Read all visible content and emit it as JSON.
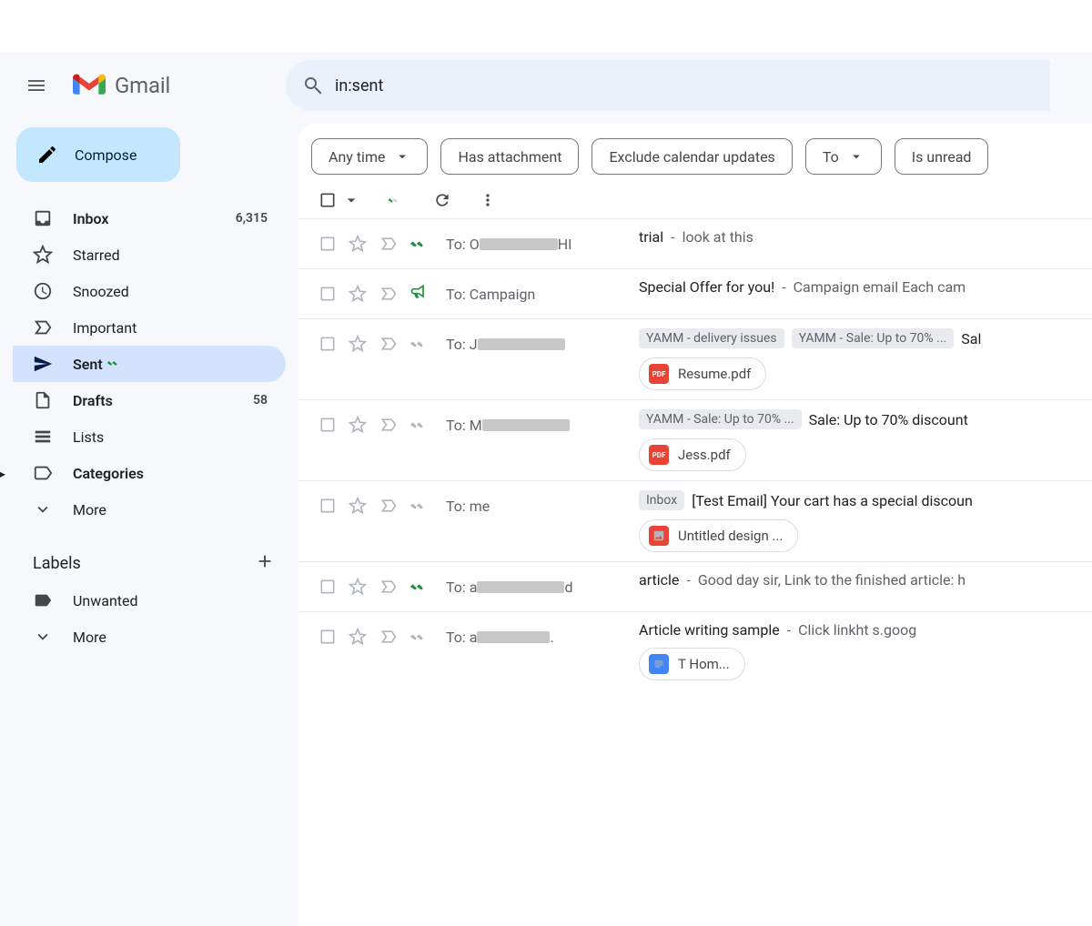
{
  "header": {
    "brand": "Gmail",
    "search_value": "in:sent"
  },
  "compose_label": "Compose",
  "sidebar": [
    {
      "icon": "inbox",
      "label": "Inbox",
      "count": "6,315",
      "bold": true
    },
    {
      "icon": "star",
      "label": "Starred"
    },
    {
      "icon": "clock",
      "label": "Snoozed"
    },
    {
      "icon": "important",
      "label": "Important"
    },
    {
      "icon": "send",
      "label": "Sent",
      "selected": true,
      "tick": true
    },
    {
      "icon": "file",
      "label": "Drafts",
      "count": "58",
      "bold": true
    },
    {
      "icon": "lists",
      "label": "Lists"
    },
    {
      "icon": "cat",
      "label": "Categories",
      "caret": true,
      "bold": true
    },
    {
      "icon": "more",
      "label": "More"
    }
  ],
  "labels_header": "Labels",
  "labels": [
    {
      "icon": "tag",
      "label": "Unwanted"
    },
    {
      "icon": "more",
      "label": "More"
    }
  ],
  "chips": [
    {
      "label": "Any time",
      "dropdown": true
    },
    {
      "label": "Has attachment"
    },
    {
      "label": "Exclude calendar updates"
    },
    {
      "label": "To",
      "dropdown": true
    },
    {
      "label": "Is unread"
    }
  ],
  "to_prefix": "To: ",
  "rows": [
    {
      "tick": "green",
      "sender_pre": "O",
      "sender_post": "HI",
      "redact": 86,
      "subject": "trial",
      "snippet": "look at this"
    },
    {
      "tick": "bullhorn",
      "sender_text": "Campaign",
      "subject": "Special Offer for you!",
      "snippet": "Campaign email Each cam"
    },
    {
      "tick": "gray",
      "sender_pre": "J",
      "redact": 96,
      "tags": [
        "YAMM - delivery issues",
        "YAMM - Sale: Up to 70% ..."
      ],
      "subject_tail": "Sal",
      "attachments": [
        {
          "type": "pdf",
          "label": "Resume.pdf"
        }
      ]
    },
    {
      "tick": "gray",
      "sender_pre": "M",
      "redact": 96,
      "tags": [
        "YAMM - Sale: Up to 70% ..."
      ],
      "subject_tail": "Sale: Up to 70% discount",
      "attachments": [
        {
          "type": "pdf",
          "label": "Jess.pdf"
        }
      ]
    },
    {
      "tick": "gray",
      "sender_text": "me",
      "tags": [
        "Inbox"
      ],
      "subject_tail": "[Test Email] Your cart has a special discoun",
      "attachments": [
        {
          "type": "img",
          "label": "Untitled design ..."
        }
      ]
    },
    {
      "tick": "green",
      "sender_pre": "a",
      "sender_post": "d",
      "redact": 96,
      "subject": "article",
      "snippet": "Good day sir, Link to the finished article: h"
    },
    {
      "tick": "gray",
      "sender_pre": "a",
      "sender_post": ".",
      "redact": 80,
      "subject": "Article writing sample",
      "snippet": "Click linkht           s.goog",
      "attachments": [
        {
          "type": "doc",
          "label": "T          Hom..."
        }
      ]
    }
  ]
}
